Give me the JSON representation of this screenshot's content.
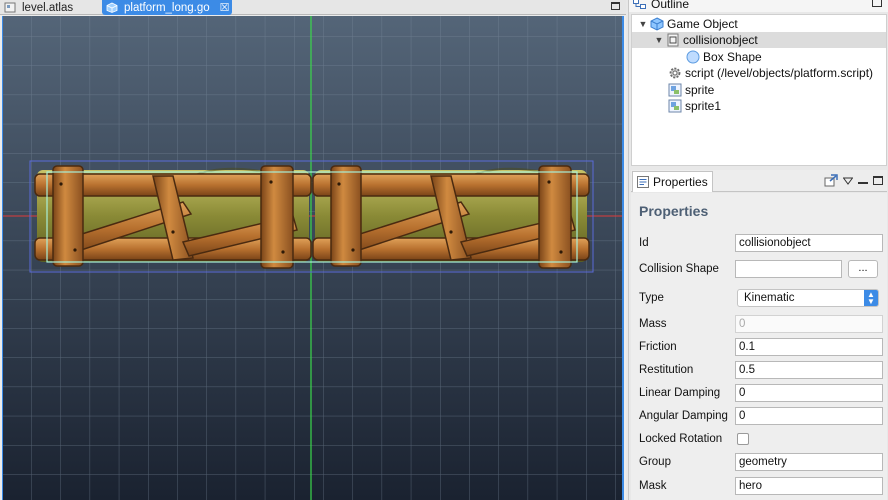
{
  "editor": {
    "tabs": [
      {
        "label": "level.atlas",
        "active": false
      },
      {
        "label": "platform_long.go",
        "active": true,
        "close": "☒"
      }
    ]
  },
  "outline": {
    "tab_label": "Outline",
    "tree": [
      {
        "label": "Game Object",
        "depth": 0,
        "expanded": true,
        "icon": "game-object-icon"
      },
      {
        "label": "collisionobject",
        "depth": 1,
        "expanded": true,
        "selected": true,
        "icon": "collision-object-icon"
      },
      {
        "label": "Box Shape",
        "depth": 2,
        "icon": "shape-icon"
      },
      {
        "label": "script (/level/objects/platform.script)",
        "depth": 1,
        "icon": "gear-icon"
      },
      {
        "label": "sprite",
        "depth": 1,
        "icon": "sprite-icon"
      },
      {
        "label": "sprite1",
        "depth": 1,
        "icon": "sprite-icon"
      }
    ]
  },
  "properties": {
    "tab_label": "Properties",
    "title": "Properties",
    "fields": {
      "id": {
        "label": "Id",
        "value": "collisionobject"
      },
      "collision_shape": {
        "label": "Collision Shape",
        "value": "",
        "button": "..."
      },
      "type": {
        "label": "Type",
        "value": "Kinematic",
        "arrows": "▲▼"
      },
      "mass": {
        "label": "Mass",
        "value": "0"
      },
      "friction": {
        "label": "Friction",
        "value": "0.1"
      },
      "restitution": {
        "label": "Restitution",
        "value": "0.5"
      },
      "linear_damping": {
        "label": "Linear Damping",
        "value": "0"
      },
      "angular_damping": {
        "label": "Angular Damping",
        "value": "0"
      },
      "locked_rotation": {
        "label": "Locked Rotation",
        "checked": false
      },
      "group": {
        "label": "Group",
        "value": "geometry"
      },
      "mask": {
        "label": "Mask",
        "value": "hero"
      }
    }
  },
  "colors": {
    "accent": "#3c8be6",
    "scene_top": "#546578",
    "scene_bottom": "#1a2230",
    "title_text": "#4d5f74"
  }
}
